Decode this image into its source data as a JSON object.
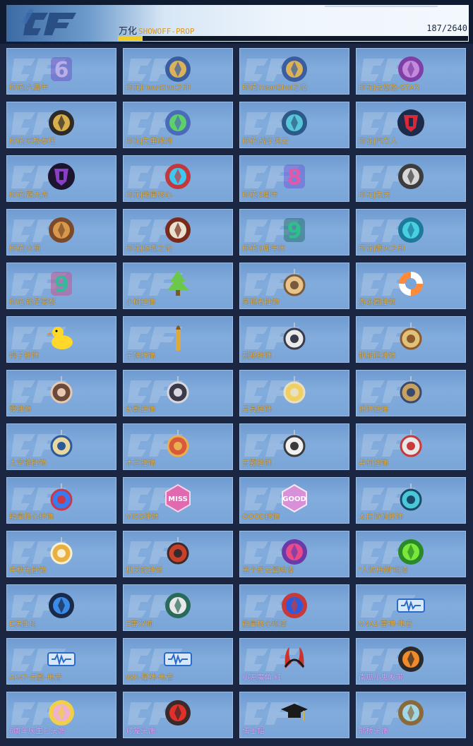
{
  "header": {
    "category": "万化",
    "category_sub": "SHOWOFF-PROP",
    "count": "187/2640",
    "progress_fraction": 0.0708
  },
  "items": [
    {
      "label": "印花|六周年",
      "icon": "number-6-badge"
    },
    {
      "label": "印花|HeartShot之印",
      "icon": "gold-shield-badge"
    },
    {
      "label": "印花|HeartShot之记",
      "icon": "gold-shield-badge"
    },
    {
      "label": "印花|云悠悠-STAR",
      "icon": "character-portrait"
    },
    {
      "label": "印花|究极泰坦",
      "icon": "dragon-emblem"
    },
    {
      "label": "印花|失重绿洲",
      "icon": "planet-rocket"
    },
    {
      "label": "印花|战争风云",
      "icon": "tank"
    },
    {
      "label": "印花|汽车人",
      "icon": "autobot-emblem"
    },
    {
      "label": "印花|霸天虎",
      "icon": "decepticon-emblem"
    },
    {
      "label": "印花|能量核心",
      "icon": "energy-core"
    },
    {
      "label": "印花|8周年",
      "icon": "number-8-badge"
    },
    {
      "label": "印花|朱厌",
      "icon": "beast-head"
    },
    {
      "label": "印花|火鼠",
      "icon": "fire-rat"
    },
    {
      "label": "印花|涿鹿之记",
      "icon": "antler-emblem"
    },
    {
      "label": "印花|9周年庆",
      "icon": "number-9"
    },
    {
      "label": "印花|烟火之印",
      "icon": "teal-wing-emblem"
    },
    {
      "label": "印花|勒是雾都",
      "icon": "number-9-tower"
    },
    {
      "label": "小树挂饰",
      "icon": "tree-charm"
    },
    {
      "label": "灵狐者挂饰",
      "icon": "fox-girl-charm"
    },
    {
      "label": "游泳圈挂饰",
      "icon": "swim-ring"
    },
    {
      "label": "鸭子挂饰",
      "icon": "rubber-duck"
    },
    {
      "label": "子弹挂饰",
      "icon": "bullet-charm"
    },
    {
      "label": "孤狼挂饰",
      "icon": "wolf-girl-charm"
    },
    {
      "label": "帆船匪挂饰",
      "icon": "sailboat-charm"
    },
    {
      "label": "零挂饰",
      "icon": "girl-charm"
    },
    {
      "label": "幻影挂饰",
      "icon": "ninja-charm"
    },
    {
      "label": "月亮挂饰",
      "icon": "moon-charm"
    },
    {
      "label": "猎神挂饰",
      "icon": "hunter-charm"
    },
    {
      "label": "太空船挂饰",
      "icon": "spaceship-charm"
    },
    {
      "label": "木兰挂饰",
      "icon": "mulan-charm"
    },
    {
      "label": "白露挂饰",
      "icon": "bird-charm"
    },
    {
      "label": "井村挂饰",
      "icon": "mask-charm"
    },
    {
      "label": "能量核心挂饰",
      "icon": "energy-core-charm"
    },
    {
      "label": "MISS挂饰",
      "icon": "miss-badge"
    },
    {
      "label": "GOOD挂饰",
      "icon": "good-badge"
    },
    {
      "label": "太白诗仙挂饰",
      "icon": "poet-charm"
    },
    {
      "label": "中秋兔挂饰",
      "icon": "rabbit-charm"
    },
    {
      "label": "机关蛇挂饰",
      "icon": "chest-charm"
    },
    {
      "label": "当个理云鬓喷漆",
      "icon": "girl-spray"
    },
    {
      "label": "“人帅枪刚”喷漆",
      "icon": "green-spray"
    },
    {
      "label": "E决胜负",
      "icon": "estar-spray"
    },
    {
      "label": "E雷双响",
      "icon": "dragon-spray"
    },
    {
      "label": "能量核心喷漆",
      "icon": "energy-core-spray"
    },
    {
      "label": "M4A1-雷神-电音",
      "icon": "audio-card"
    },
    {
      "label": "AK47-无影-电音",
      "icon": "audio-card"
    },
    {
      "label": "98K-星神-电音",
      "icon": "audio-card"
    },
    {
      "label": "小恶魔角-红",
      "icon": "devil-horns",
      "purple": true
    },
    {
      "label": "南瓜小鬼发带",
      "icon": "pumpkin-headband",
      "purple": true
    },
    {
      "label": "6周年庆生日头饰",
      "icon": "birthday-headwear",
      "purple": true
    },
    {
      "label": "灯笼头饰",
      "icon": "lantern-headwear",
      "purple": true
    },
    {
      "label": "博士帽",
      "icon": "graduation-cap",
      "purple": true
    },
    {
      "label": "鹊桥头饰",
      "icon": "bridge-headwear",
      "purple": true
    }
  ]
}
